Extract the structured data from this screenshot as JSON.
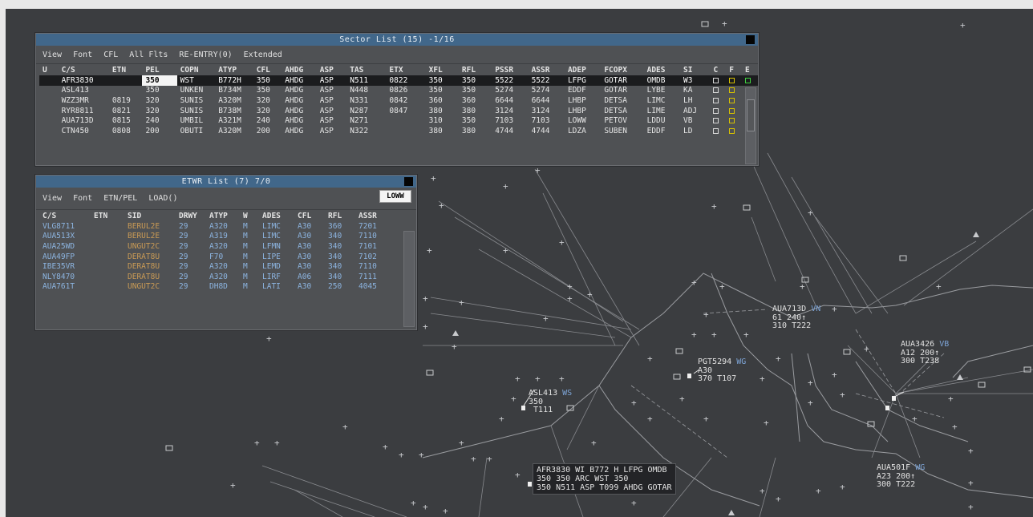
{
  "sector_list": {
    "title": "Sector List (15) -1/16",
    "menu": [
      "View",
      "Font",
      "CFL",
      "All Flts",
      "RE-ENTRY(0)",
      "Extended"
    ],
    "columns": [
      "U",
      "C/S",
      "ETN",
      "PEL",
      "COPN",
      "ATYP",
      "CFL",
      "AHDG",
      "ASP",
      "TAS",
      "ETX",
      "XFL",
      "RFL",
      "PSSR",
      "ASSR",
      "ADEP",
      "FCOPX",
      "ADES",
      "SI",
      "C",
      "F",
      "E"
    ],
    "rows": [
      [
        "",
        "AFR3830",
        "",
        "350",
        "WST",
        "B772H",
        "350",
        "AHDG",
        "ASP",
        "N511",
        "0822",
        "350",
        "350",
        "5522",
        "5522",
        "LFPG",
        "GOTAR",
        "OMDB",
        "W3"
      ],
      [
        "",
        "ASL413",
        "",
        "350",
        "UNKEN",
        "B734M",
        "350",
        "AHDG",
        "ASP",
        "N448",
        "0826",
        "350",
        "350",
        "5274",
        "5274",
        "EDDF",
        "GOTAR",
        "LYBE",
        "KA"
      ],
      [
        "",
        "WZZ3MR",
        "0819",
        "320",
        "SUNIS",
        "A320M",
        "320",
        "AHDG",
        "ASP",
        "N331",
        "0842",
        "360",
        "360",
        "6644",
        "6644",
        "LHBP",
        "DETSA",
        "LIMC",
        "LH"
      ],
      [
        "",
        "RYR8811",
        "0821",
        "320",
        "SUNIS",
        "B738M",
        "320",
        "AHDG",
        "ASP",
        "N287",
        "0847",
        "380",
        "380",
        "3124",
        "3124",
        "LHBP",
        "DETSA",
        "LIME",
        "ADJ"
      ],
      [
        "",
        "AUA713D",
        "0815",
        "240",
        "UMBIL",
        "A321M",
        "240",
        "AHDG",
        "ASP",
        "N271",
        "",
        "310",
        "350",
        "7103",
        "7103",
        "LOWW",
        "PETOV",
        "LDDU",
        "VB"
      ],
      [
        "",
        "CTN450",
        "0808",
        "200",
        "OBUTI",
        "A320M",
        "200",
        "AHDG",
        "ASP",
        "N322",
        "",
        "380",
        "380",
        "4744",
        "4744",
        "LDZA",
        "SUBEN",
        "EDDF",
        "LD"
      ]
    ]
  },
  "etwr_list": {
    "title": "ETWR List (7) 7/0",
    "menu": [
      "View",
      "Font",
      "ETN/PEL",
      "LOAD()"
    ],
    "airport": "LOWW",
    "columns": [
      "C/S",
      "ETN",
      "SID",
      "DRWY",
      "ATYP",
      "W",
      "ADES",
      "CFL",
      "RFL",
      "ASSR"
    ],
    "rows": [
      [
        "VLG8711",
        "",
        "BERUL2E",
        "29",
        "A320",
        "M",
        "LIMC",
        "A30",
        "360",
        "7201"
      ],
      [
        "AUA513X",
        "",
        "BERUL2E",
        "29",
        "A319",
        "M",
        "LIMC",
        "A30",
        "340",
        "7110"
      ],
      [
        "AUA25WD",
        "",
        "UNGUT2C",
        "29",
        "A320",
        "M",
        "LFMN",
        "A30",
        "340",
        "7101"
      ],
      [
        "AUA49FP",
        "",
        "DERAT8U",
        "29",
        "F70",
        "M",
        "LIPE",
        "A30",
        "340",
        "7102"
      ],
      [
        "IBE35VR",
        "",
        "DERAT8U",
        "29",
        "A320",
        "M",
        "LEMD",
        "A30",
        "340",
        "7110"
      ],
      [
        "NLY8470",
        "",
        "DERAT8U",
        "29",
        "A320",
        "M",
        "LIRF",
        "A06",
        "340",
        "7111"
      ],
      [
        "AUA761T",
        "",
        "UNGUT2C",
        "29",
        "DH8D",
        "M",
        "LATI",
        "A30",
        "250",
        "4045"
      ]
    ]
  },
  "tracks": {
    "aua713d": {
      "l1": "AUA713D",
      "l1v": "VN",
      "l2": "61 240↑",
      "l3": "310 T222"
    },
    "pgt5294": {
      "l1": "PGT5294",
      "l1v": "WG",
      "l2": "A30",
      "l3": "370 T107"
    },
    "asl413": {
      "l1": "ASL413",
      "l1v": "WS",
      "l2": "350",
      "l3": "T111"
    },
    "aua3426": {
      "l1": "AUA3426",
      "l1v": "VB",
      "l2": "A12 200↑",
      "l3": "300 T238"
    },
    "aua501f": {
      "l1": "AUA501F",
      "l1v": "WG",
      "l2": "A23 200↑",
      "l3": "300 T222"
    },
    "afr3830": {
      "l1": "AFR3830 WI B772 H LFPG OMDB",
      "l2": "350 350 ARC WST 350",
      "l3": "350 N511 ASP T099 AHDG GOTAR"
    }
  },
  "colors": {
    "background": "#3b3d40",
    "titlebar": "#41678a",
    "callsign_blue": "#8cb4e0",
    "sid_orange": "#c99a55"
  }
}
